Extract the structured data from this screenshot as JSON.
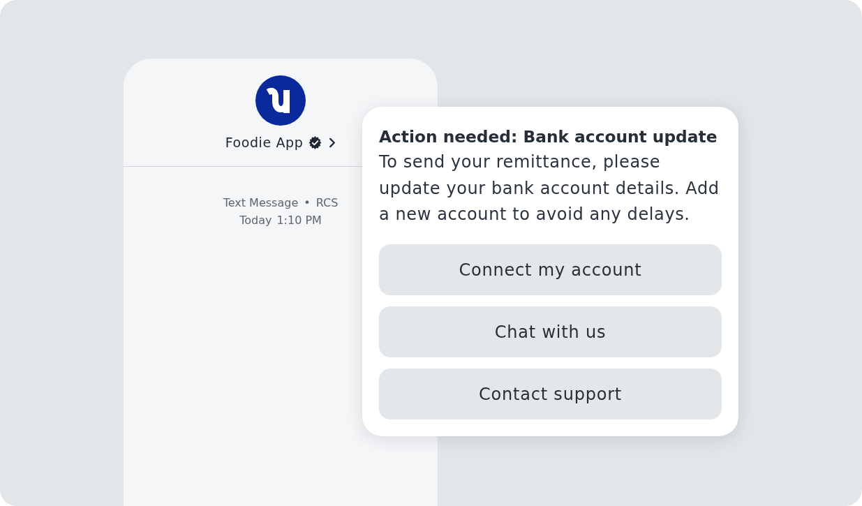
{
  "contact": {
    "name": "Foodie App",
    "verified": true
  },
  "thread_info": {
    "channel": "Text Message",
    "separator": "•",
    "protocol": "RCS",
    "day": "Today",
    "time": "1:10 PM"
  },
  "message": {
    "title": "Action needed: Bank account update",
    "body": "To send your remittance, please update your bank account details. Add a new account to avoid any delays.",
    "actions": [
      {
        "label": "Connect my account"
      },
      {
        "label": "Chat with us"
      },
      {
        "label": "Contact support"
      }
    ]
  }
}
